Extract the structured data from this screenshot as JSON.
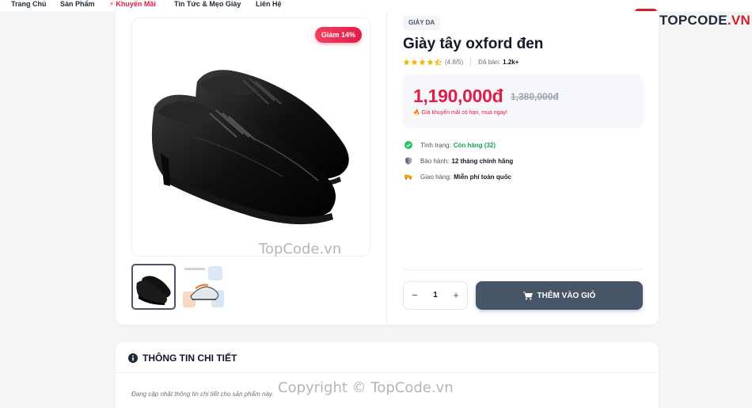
{
  "nav": {
    "items": [
      {
        "label": "Trang Chủ",
        "active": false
      },
      {
        "label": "Sản Phẩm",
        "active": false
      },
      {
        "label": "Khuyến Mãi",
        "active": true,
        "icon": "bolt-icon"
      },
      {
        "label": "Tin Tức & Mẹo Giày",
        "active": false
      },
      {
        "label": "Liên Hệ",
        "active": false
      }
    ]
  },
  "logo": {
    "text_main": "TOPCODE",
    "text_suffix": ".VN",
    "brand_color": "#d61f26"
  },
  "product": {
    "discount_badge": "Giảm 14%",
    "category": "GIÀY DA",
    "title": "Giày tây oxford đen",
    "rating": {
      "value": 4.5,
      "text": "(4.8/5)",
      "sold_label": "Đã bán:",
      "sold_value": "1.2k+"
    },
    "price": {
      "current": "1,190,000đ",
      "old": "1,380,000đ",
      "note": "Giá khuyến mãi có hạn, mua ngay!"
    },
    "info": {
      "stock_label": "Tình trạng:",
      "stock_value": "Còn hàng (32)",
      "warranty_label": "Bảo hành:",
      "warranty_value": "12 tháng chính hãng",
      "shipping_label": "Giao hàng:",
      "shipping_value": "Miễn phí toàn quốc"
    },
    "quantity": "1",
    "add_to_cart_label": "THÊM VÀO GIỎ"
  },
  "detail": {
    "title": "THÔNG TIN CHI TIẾT",
    "body": "Đang cập nhật thông tin chi tiết cho sản phẩm này."
  },
  "watermark": {
    "image_text": "TopCode.vn",
    "footer_text": "Copyright © TopCode.vn"
  },
  "colors": {
    "accent": "#e11d48",
    "button": "#475569",
    "success": "#16a34a",
    "star": "#f5b50a"
  }
}
